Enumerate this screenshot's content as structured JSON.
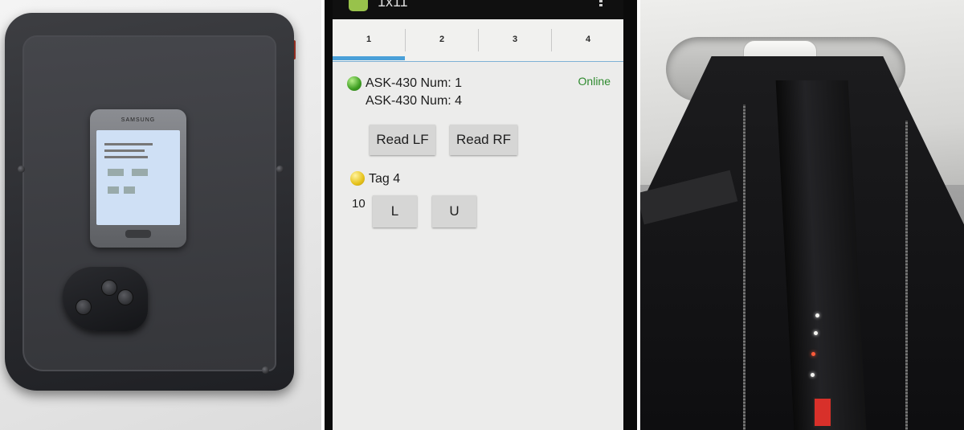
{
  "left_photo": {
    "phone_brand": "SAMSUNG"
  },
  "app": {
    "title": "1x11",
    "tabs": [
      {
        "label": "1",
        "selected": true
      },
      {
        "label": "2",
        "selected": false
      },
      {
        "label": "3",
        "selected": false
      },
      {
        "label": "4",
        "selected": false
      }
    ],
    "devices": {
      "line1": "ASK-430 Num: 1",
      "line2": "ASK-430 Num: 4",
      "status": "Online",
      "status_color": "#2e8a2e",
      "indicator_color": "green"
    },
    "buttons": {
      "read_lf": "Read LF",
      "read_rf": "Read RF"
    },
    "tag": {
      "label": "Tag 4",
      "indicator_color": "yellow",
      "value": "10",
      "button_l": "L",
      "button_u": "U"
    },
    "accent_color": "#4aa0d8"
  }
}
